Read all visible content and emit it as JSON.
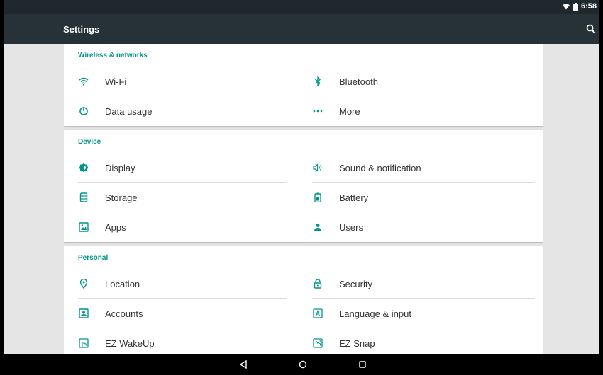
{
  "status": {
    "time": "6:58",
    "icons": [
      "wifi-icon",
      "battery-icon"
    ]
  },
  "appbar": {
    "title": "Settings",
    "search_icon": "search-icon"
  },
  "accent": "#009688",
  "sections": [
    {
      "title": "Wireless & networks",
      "items": [
        {
          "label": "Wi-Fi",
          "icon": "wifi-icon"
        },
        {
          "label": "Bluetooth",
          "icon": "bluetooth-icon"
        },
        {
          "label": "Data usage",
          "icon": "data-usage-icon"
        },
        {
          "label": "More",
          "icon": "more-icon"
        }
      ]
    },
    {
      "title": "Device",
      "items": [
        {
          "label": "Display",
          "icon": "display-icon"
        },
        {
          "label": "Sound & notification",
          "icon": "sound-icon"
        },
        {
          "label": "Storage",
          "icon": "storage-icon"
        },
        {
          "label": "Battery",
          "icon": "battery-icon"
        },
        {
          "label": "Apps",
          "icon": "apps-icon"
        },
        {
          "label": "Users",
          "icon": "users-icon"
        }
      ]
    },
    {
      "title": "Personal",
      "items": [
        {
          "label": "Location",
          "icon": "location-icon"
        },
        {
          "label": "Security",
          "icon": "security-icon"
        },
        {
          "label": "Accounts",
          "icon": "accounts-icon"
        },
        {
          "label": "Language & input",
          "icon": "language-icon"
        },
        {
          "label": "EZ WakeUp",
          "icon": "ez-wakeup-icon"
        },
        {
          "label": "EZ Snap",
          "icon": "ez-snap-icon"
        }
      ]
    }
  ],
  "navbar": {
    "icons": [
      "back-icon",
      "home-icon",
      "recents-icon"
    ]
  }
}
